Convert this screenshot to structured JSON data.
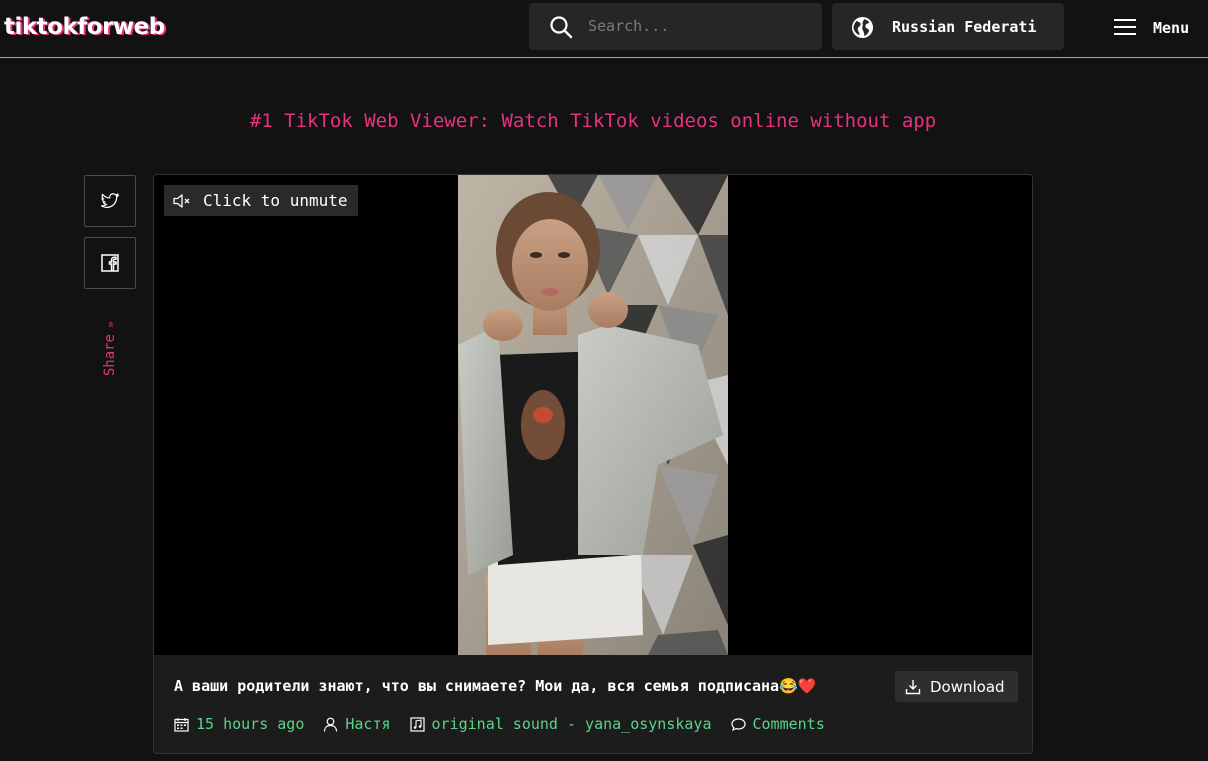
{
  "header": {
    "logo": "tiktokforweb",
    "search_placeholder": "Search...",
    "region_label": "Russian Federati",
    "menu_label": "Menu"
  },
  "headline": "#1 TikTok Web Viewer: Watch TikTok videos online without app",
  "share": {
    "label": "Share",
    "chevron": "»",
    "buttons": [
      {
        "icon": "twitter-icon"
      },
      {
        "icon": "facebook-icon"
      }
    ]
  },
  "video": {
    "unmute_label": "Click to unmute",
    "caption": "А ваши родители знают, что вы снимаете? Мои да, вся семья подписана😂❤️",
    "download_label": "Download",
    "meta": {
      "time": "15 hours ago",
      "author": "Настя",
      "sound": "original sound - yana_osynskaya",
      "comments": "Comments"
    }
  },
  "colors": {
    "accent_pink": "#e8317f",
    "accent_green": "#5bd48a",
    "background": "#121212"
  }
}
